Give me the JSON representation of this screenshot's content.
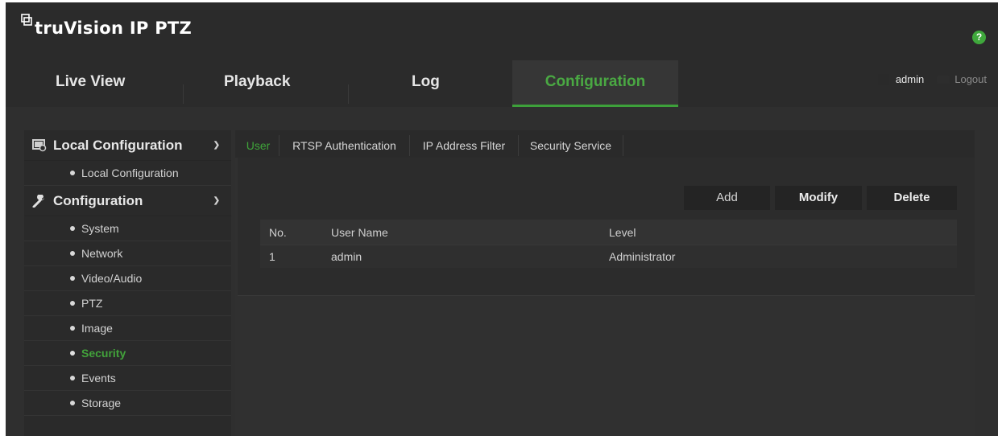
{
  "app": {
    "title": "truVision IP PTZ",
    "help_label": "?"
  },
  "nav": {
    "items": [
      {
        "label": "Live View",
        "active": false
      },
      {
        "label": "Playback",
        "active": false
      },
      {
        "label": "Log",
        "active": false
      },
      {
        "label": "Configuration",
        "active": true
      }
    ],
    "user": "admin",
    "logout": "Logout"
  },
  "sidebar": {
    "local_group": "Local Configuration",
    "local_items": [
      "Local Configuration"
    ],
    "config_group": "Configuration",
    "config_items": [
      "System",
      "Network",
      "Video/Audio",
      "PTZ",
      "Image",
      "Security",
      "Events",
      "Storage"
    ],
    "active_item": "Security"
  },
  "tabs": [
    "User",
    "RTSP Authentication",
    "IP Address Filter",
    "Security Service"
  ],
  "active_tab": "User",
  "buttons": {
    "add": "Add",
    "modify": "Modify",
    "delete": "Delete"
  },
  "user_table": {
    "columns": [
      "No.",
      "User Name",
      "Level"
    ],
    "rows": [
      [
        "1",
        "admin",
        "Administrator"
      ]
    ]
  },
  "colors": {
    "accent": "#42a33b",
    "background": "#2f2f2f"
  }
}
